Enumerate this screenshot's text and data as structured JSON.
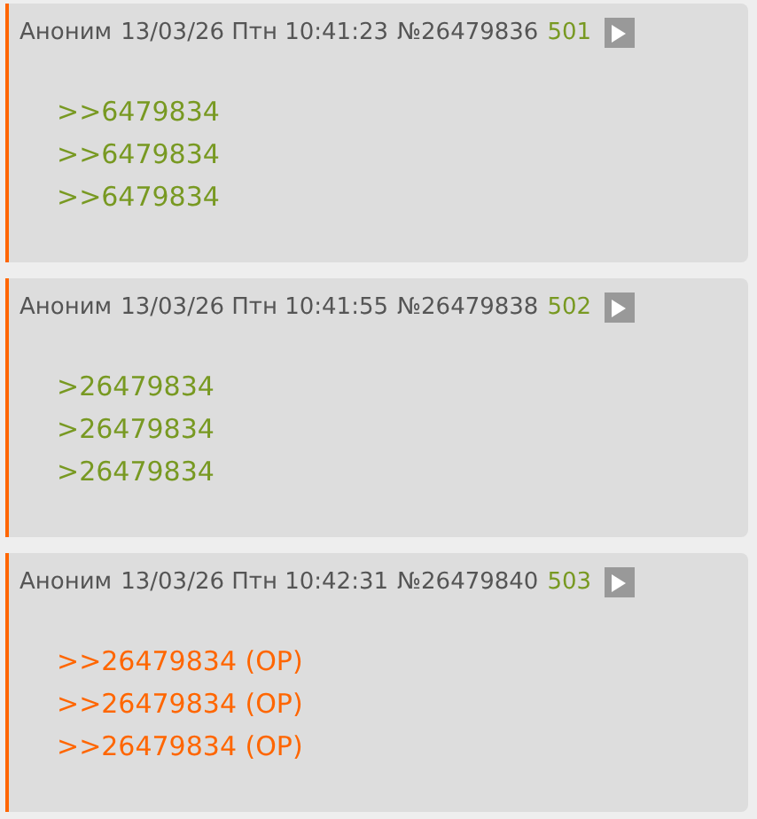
{
  "posts": [
    {
      "name": "Аноним",
      "date": "13/03/26 Птн 10:41:23",
      "number": "№26479836",
      "index": "501",
      "lines": [
        {
          "kind": "reply",
          "text": ">>6479834"
        },
        {
          "kind": "reply",
          "text": ">>6479834"
        },
        {
          "kind": "reply",
          "text": ">>6479834"
        }
      ]
    },
    {
      "name": "Аноним",
      "date": "13/03/26 Птн 10:41:55",
      "number": "№26479838",
      "index": "502",
      "lines": [
        {
          "kind": "reply",
          "text": ">26479834"
        },
        {
          "kind": "reply",
          "text": ">26479834"
        },
        {
          "kind": "reply",
          "text": ">26479834"
        }
      ]
    },
    {
      "name": "Аноним",
      "date": "13/03/26 Птн 10:42:31",
      "number": "№26479840",
      "index": "503",
      "lines": [
        {
          "kind": "op",
          "text": ">>26479834 (OP)"
        },
        {
          "kind": "op",
          "text": ">>26479834 (OP)"
        },
        {
          "kind": "op",
          "text": ">>26479834 (OP)"
        }
      ]
    }
  ]
}
